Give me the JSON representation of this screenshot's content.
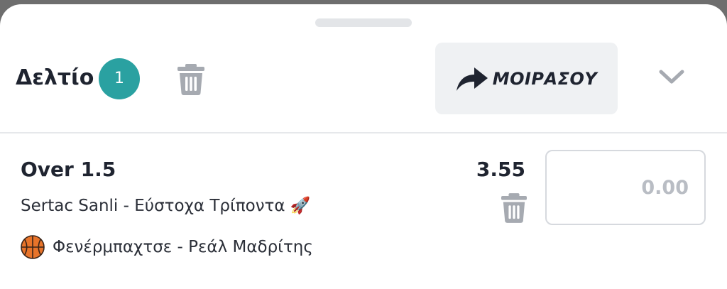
{
  "betslip": {
    "title": "Δελτίο",
    "count": "1",
    "share_label": "ΜΟΙΡΑΣΟΥ"
  },
  "bet": {
    "market": "Over 1.5",
    "odds": "3.55",
    "selection": "Sertac Sanli - Εύστοχα Τρίποντα 🚀",
    "event": "Φενέρμπαχτσε - Ρεάλ Μαδρίτης",
    "sport_icon": "basketball-icon",
    "stake_placeholder": "0.00"
  },
  "icons": {
    "header_delete": "trash-icon",
    "share": "share-arrow-icon",
    "collapse": "chevron-down-icon",
    "bet_delete": "trash-icon"
  },
  "colors": {
    "badge": "#2aa1a1",
    "text": "#1f2430",
    "icon_gray": "#a6aab1",
    "button_bg": "#eff1f3"
  }
}
